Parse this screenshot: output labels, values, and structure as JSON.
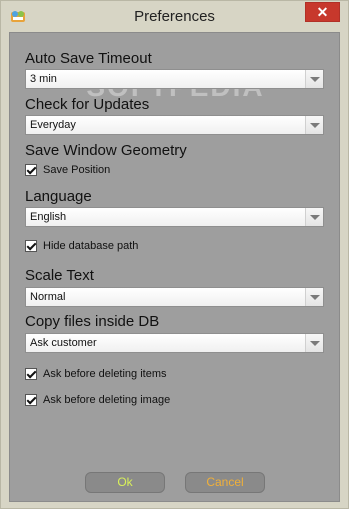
{
  "window": {
    "title": "Preferences",
    "close_glyph": "✕"
  },
  "watermark": "SOFTPEDIA",
  "auto_save": {
    "label": "Auto Save Timeout",
    "value": "3 min"
  },
  "check_updates": {
    "label": "Check for Updates",
    "value": "Everyday"
  },
  "window_geometry": {
    "label": "Save Window Geometry",
    "save_position": {
      "label": "Save Position",
      "checked": true
    }
  },
  "language": {
    "label": "Language",
    "value": "English"
  },
  "hide_db_path": {
    "label": "Hide database path",
    "checked": true
  },
  "scale_text": {
    "label": "Scale Text",
    "value": "Normal"
  },
  "copy_files": {
    "label": "Copy files inside DB",
    "value": "Ask customer"
  },
  "ask_delete_items": {
    "label": "Ask before deleting items",
    "checked": true
  },
  "ask_delete_image": {
    "label": "Ask before deleting image",
    "checked": true
  },
  "buttons": {
    "ok": "Ok",
    "cancel": "Cancel"
  },
  "colors": {
    "ok_text": "#d8f05a",
    "cancel_text": "#f0b03a",
    "close_button": "#c7382c"
  }
}
